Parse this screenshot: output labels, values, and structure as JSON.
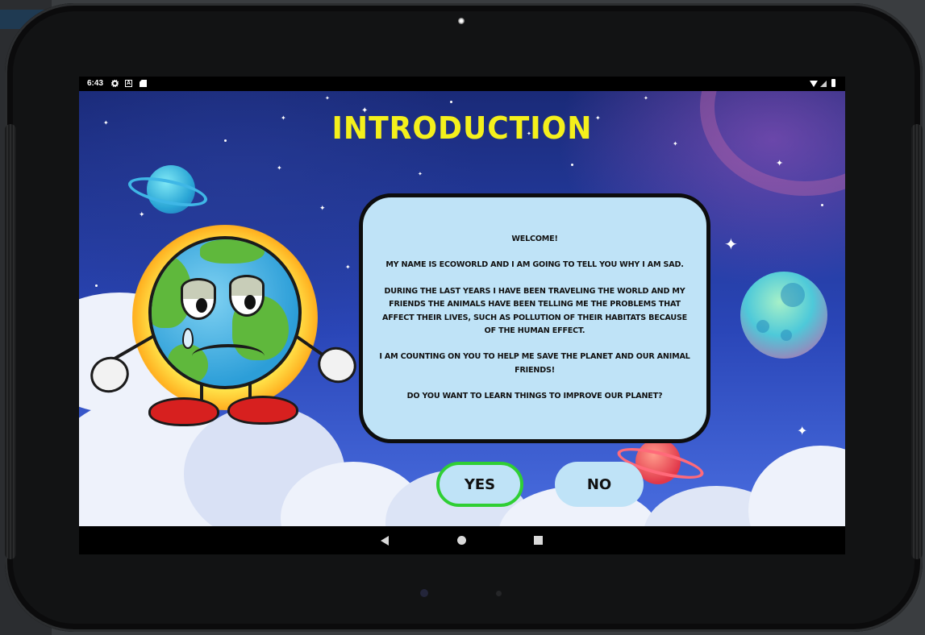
{
  "status_bar": {
    "time": "6:43",
    "icons": [
      "gear-icon",
      "a-icon",
      "sd-card-icon",
      "wifi-icon",
      "signal-icon",
      "battery-icon"
    ]
  },
  "screen": {
    "title": "INTRODUCTION",
    "dialog": {
      "paragraphs": [
        "WELCOME!",
        "MY NAME IS ECOWORLD AND I AM GOING TO TELL YOU WHY I AM SAD.",
        "DURING THE LAST YEARS I HAVE BEEN TRAVELING THE WORLD AND MY FRIENDS THE ANIMALS HAVE BEEN TELLING ME THE PROBLEMS THAT AFFECT THEIR LIVES, SUCH AS POLLUTION OF THEIR HABITATS BECAUSE OF THE HUMAN EFFECT.",
        "I AM COUNTING ON YOU TO HELP ME SAVE THE PLANET AND OUR ANIMAL FRIENDS!",
        "DO YOU WANT TO LEARN THINGS TO IMPROVE OUR PLANET?"
      ]
    },
    "buttons": {
      "yes": "YES",
      "no": "NO"
    }
  },
  "nav_bar": {
    "icons": [
      "back-icon",
      "home-icon",
      "recents-icon"
    ]
  },
  "colors": {
    "title": "#f4f01c",
    "card_bg": "#bfe3f7",
    "yes_border": "#2fcf34",
    "sky_top": "#1a2a78",
    "sky_bottom": "#4a6ee0"
  }
}
